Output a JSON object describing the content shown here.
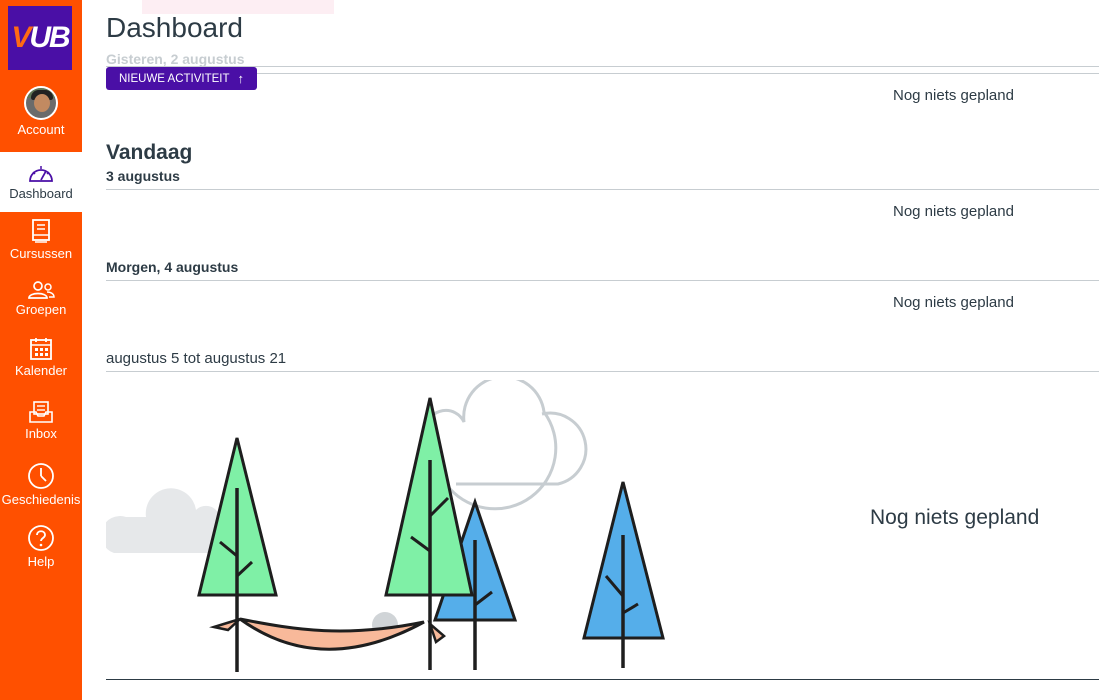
{
  "brand": {
    "logo_text_v": "V",
    "logo_text_rest": "UB",
    "primary_color": "#4a0fa6",
    "nav_color": "#ff5000"
  },
  "nav": {
    "items": [
      {
        "label": "Account",
        "icon": "avatar"
      },
      {
        "label": "Dashboard",
        "icon": "dashboard-icon"
      },
      {
        "label": "Cursussen",
        "icon": "book-icon"
      },
      {
        "label": "Groepen",
        "icon": "groups-icon"
      },
      {
        "label": "Kalender",
        "icon": "calendar-icon"
      },
      {
        "label": "Inbox",
        "icon": "inbox-icon"
      },
      {
        "label": "Geschiedenis",
        "icon": "clock-icon"
      },
      {
        "label": "Help",
        "icon": "help-icon"
      }
    ]
  },
  "main": {
    "title": "Dashboard",
    "faded_date": "Gisteren, 2 augustus",
    "new_activity_label": "NIEUWE ACTIVITEIT",
    "empty_text": "Nog niets gepland",
    "today": {
      "heading": "Vandaag",
      "date": "3 augustus"
    },
    "tomorrow": {
      "heading": "Morgen, 4 augustus"
    },
    "range": "augustus 5 tot augustus 21"
  }
}
